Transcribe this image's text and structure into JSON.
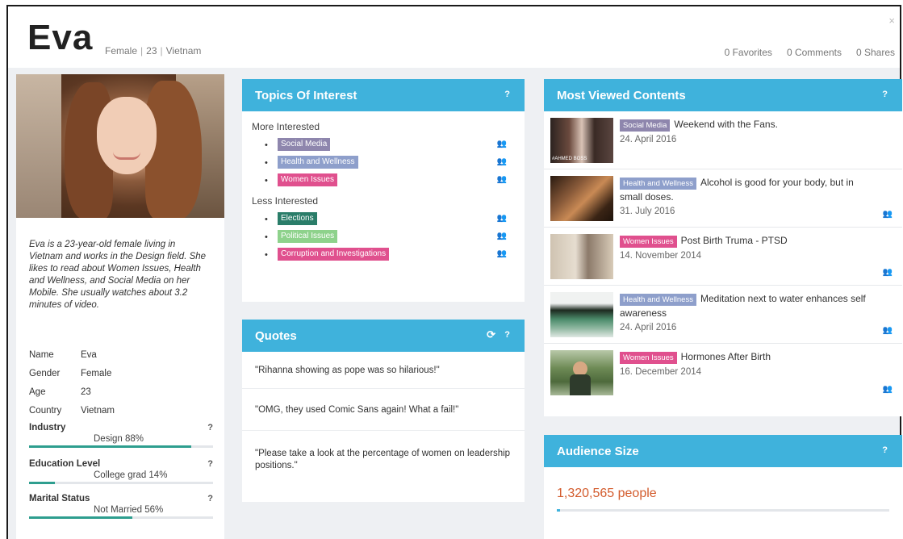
{
  "profile": {
    "name": "Eva",
    "gender": "Female",
    "age": "23",
    "country": "Vietnam",
    "bio": "Eva is a 23-year-old female living in Vietnam and works in the Design field. She likes to read about Women Issues, Health and Wellness, and Social Media on her Mobile. She usually watches about 3.2 minutes of video."
  },
  "stats": {
    "favorites": "0 Favorites",
    "comments": "0 Comments",
    "shares": "0 Shares"
  },
  "facts": [
    {
      "key": "Name",
      "value": "Eva"
    },
    {
      "key": "Gender",
      "value": "Female"
    },
    {
      "key": "Age",
      "value": "23"
    },
    {
      "key": "Country",
      "value": "Vietnam"
    }
  ],
  "metrics": [
    {
      "label": "Industry",
      "value": "Design 88%",
      "percent": 0.88,
      "help": "?"
    },
    {
      "label": "Education Level",
      "value": "College grad 14%",
      "percent": 0.14,
      "help": "?"
    },
    {
      "label": "Marital Status",
      "value": "Not Married 56%",
      "percent": 0.56,
      "help": "?"
    }
  ],
  "topics": {
    "title": "Topics Of Interest",
    "help": "?",
    "more_title": "More Interested",
    "less_title": "Less Interested",
    "more": [
      {
        "label": "Social Media",
        "color": "#8e86ad"
      },
      {
        "label": "Health and Wellness",
        "color": "#8e9fcb"
      },
      {
        "label": "Women Issues",
        "color": "#e0508e"
      }
    ],
    "less": [
      {
        "label": "Elections",
        "color": "#2a7d69"
      },
      {
        "label": "Political Issues",
        "color": "#8ed28c"
      },
      {
        "label": "Corruption and Investigations",
        "color": "#e0508e"
      }
    ]
  },
  "quotes": {
    "title": "Quotes",
    "refresh": "⟳",
    "help": "?",
    "items": [
      "\"Rihanna showing as pope was so hilarious!\"",
      "\"OMG, they used Comic Sans again! What a fail!\"",
      "\"Please take a look at the percentage of women on leadership positions.\""
    ]
  },
  "most_viewed": {
    "title": "Most Viewed Contents",
    "help": "?",
    "items": [
      {
        "tag": "Social Media",
        "color": "#8e86ad",
        "title": "Weekend with the Fans.",
        "date": "24. April 2016",
        "thumb_label": "#AHMED BOSS",
        "show_people": false
      },
      {
        "tag": "Health and Wellness",
        "color": "#8e9fcb",
        "title": "Alcohol is good for your body, but in small doses.",
        "date": "31. July 2016",
        "show_people": true
      },
      {
        "tag": "Women Issues",
        "color": "#e0508e",
        "title": "Post Birth Truma - PTSD",
        "date": "14. November 2014",
        "show_people": true
      },
      {
        "tag": "Health and Wellness",
        "color": "#8e9fcb",
        "title": "Meditation next to water enhances self awareness",
        "date": "24. April 2016",
        "show_people": true
      },
      {
        "tag": "Women Issues",
        "color": "#e0508e",
        "title": "Hormones After Birth",
        "date": "16. December 2014",
        "show_people": true
      }
    ]
  },
  "audience": {
    "title": "Audience Size",
    "help": "?",
    "value": "1,320,565 people",
    "percent": 0.01
  },
  "icons": {
    "close": "close-icon",
    "people": "people-icon",
    "help": "question-icon",
    "refresh": "refresh-icon"
  }
}
